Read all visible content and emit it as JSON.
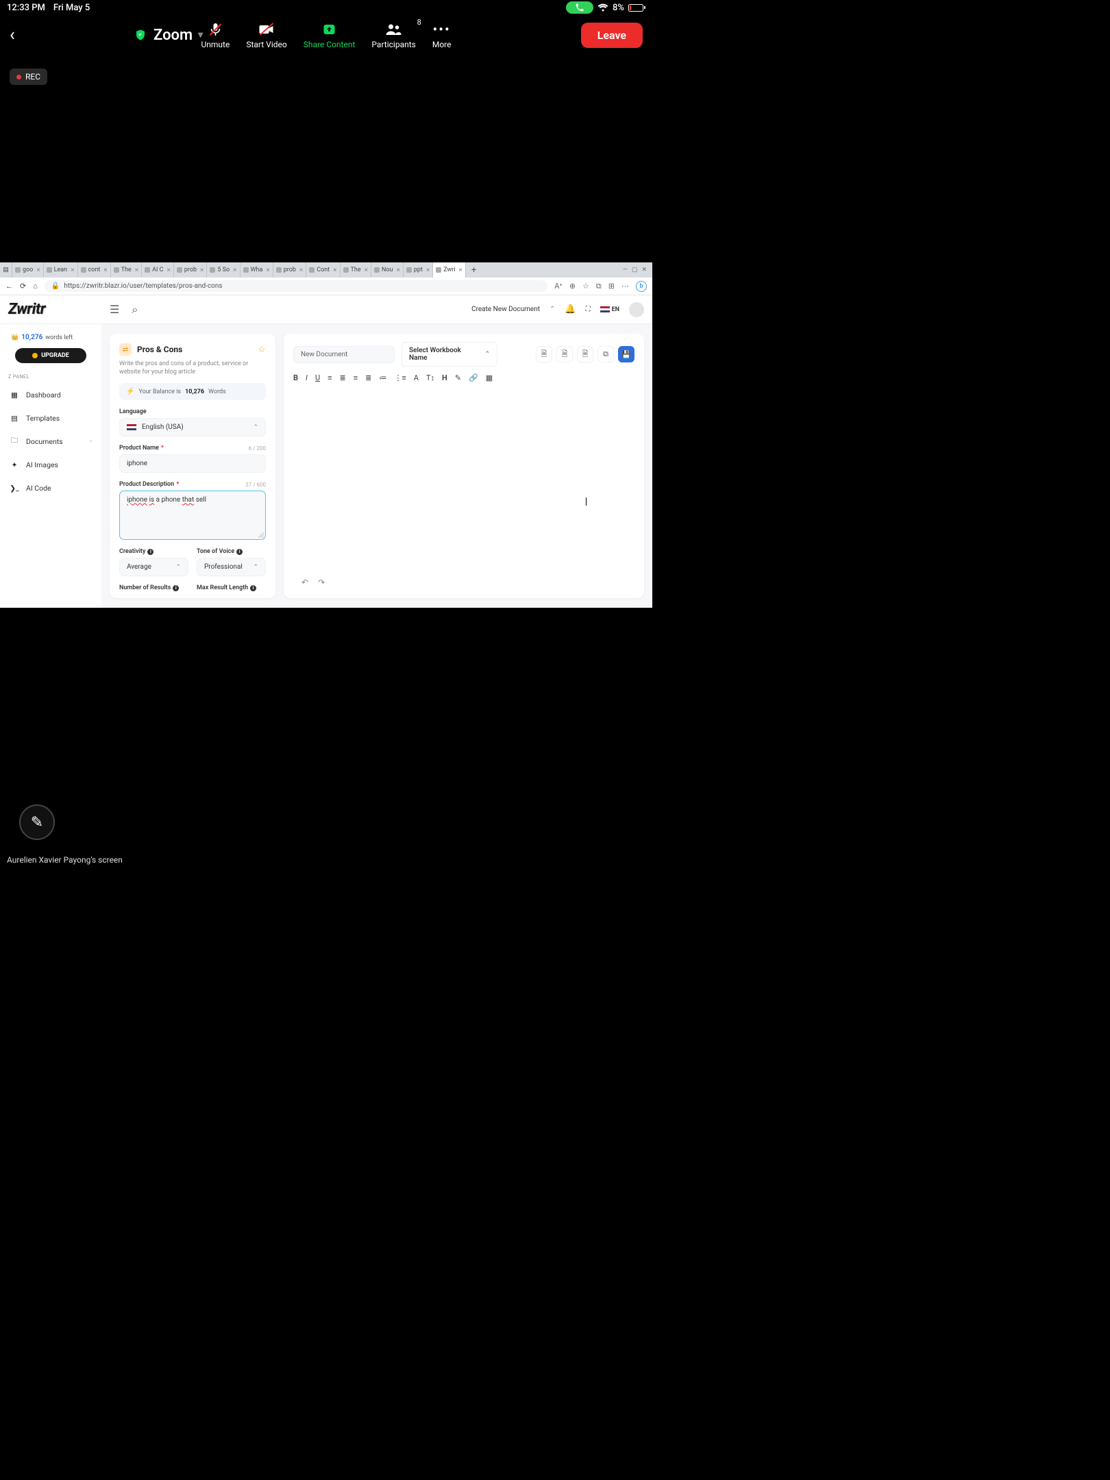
{
  "status": {
    "time": "12:33 PM",
    "date": "Fri May 5",
    "battery": "8%"
  },
  "zoom": {
    "app": "Zoom",
    "unmute": "Unmute",
    "start_video": "Start Video",
    "share": "Share Content",
    "participants": "Participants",
    "participants_count": "8",
    "more": "More",
    "leave": "Leave",
    "rec": "REC"
  },
  "footer": {
    "screen_label": "Aurelien Xavier Payong's screen"
  },
  "browser": {
    "tabs": [
      {
        "label": "goo"
      },
      {
        "label": "Lean"
      },
      {
        "label": "cont"
      },
      {
        "label": "The"
      },
      {
        "label": "AI C"
      },
      {
        "label": "prob"
      },
      {
        "label": "5 So"
      },
      {
        "label": "Wha"
      },
      {
        "label": "prob"
      },
      {
        "label": "Cont"
      },
      {
        "label": "The"
      },
      {
        "label": "Nou"
      },
      {
        "label": "ppt"
      },
      {
        "label": "Zwri",
        "active": true
      }
    ],
    "url": "https://zwritr.blazr.io/user/templates/pros-and-cons"
  },
  "app": {
    "logo": "Zwritr",
    "create_doc": "Create New Document",
    "lang_short": "EN",
    "sidebar": {
      "words_count": "10,276",
      "words_label": "words left",
      "upgrade": "UPGRADE",
      "panel_label": "Z PANEL",
      "items": [
        {
          "label": "Dashboard"
        },
        {
          "label": "Templates"
        },
        {
          "label": "Documents",
          "chevron": true
        },
        {
          "label": "AI Images"
        },
        {
          "label": "AI Code"
        }
      ]
    },
    "form": {
      "title": "Pros & Cons",
      "subtitle": "Write the pros and cons of a product, service or website for your blog article",
      "balance_prefix": "Your Balance is",
      "balance_num": "10,276",
      "balance_suffix": "Words",
      "language_label": "Language",
      "language_value": "English (USA)",
      "product_name_label": "Product Name",
      "product_name_counter": "6 / 200",
      "product_name_value": "iphone",
      "product_desc_label": "Product Description",
      "product_desc_counter": "27 / 600",
      "product_desc_w1": "iphone",
      "product_desc_w2": "is",
      "product_desc_mid": " a phone ",
      "product_desc_w3": "that",
      "product_desc_end": " sell",
      "creativity_label": "Creativity",
      "creativity_value": "Average",
      "tone_label": "Tone of Voice",
      "tone_value": "Professional",
      "num_results_label": "Number of Results",
      "max_length_label": "Max Result Length"
    },
    "doc": {
      "name_placeholder": "New Document",
      "workbook": "Select Workbook Name"
    }
  }
}
